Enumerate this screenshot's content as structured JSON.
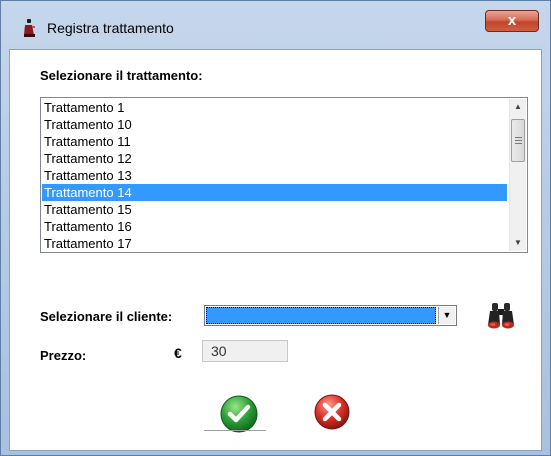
{
  "window": {
    "title": "Registra trattamento",
    "close_symbol": "x"
  },
  "treatments": {
    "label": "Selezionare il trattamento:",
    "items": [
      "Trattamento 1",
      "Trattamento 10",
      "Trattamento 11",
      "Trattamento 12",
      "Trattamento 13",
      "Trattamento 14",
      "Trattamento 15",
      "Trattamento 16",
      "Trattamento 17"
    ],
    "selected": "Trattamento 14"
  },
  "client": {
    "label": "Selezionare il cliente:",
    "value": "",
    "search_icon": "binoculars-icon"
  },
  "price": {
    "label": "Prezzo:",
    "currency": "€",
    "value": "30"
  },
  "actions": {
    "confirm_icon": "check-icon",
    "cancel_icon": "cross-icon"
  },
  "colors": {
    "selection": "#3399ff",
    "confirm": "#2fa33a",
    "cancel": "#d9342b"
  }
}
